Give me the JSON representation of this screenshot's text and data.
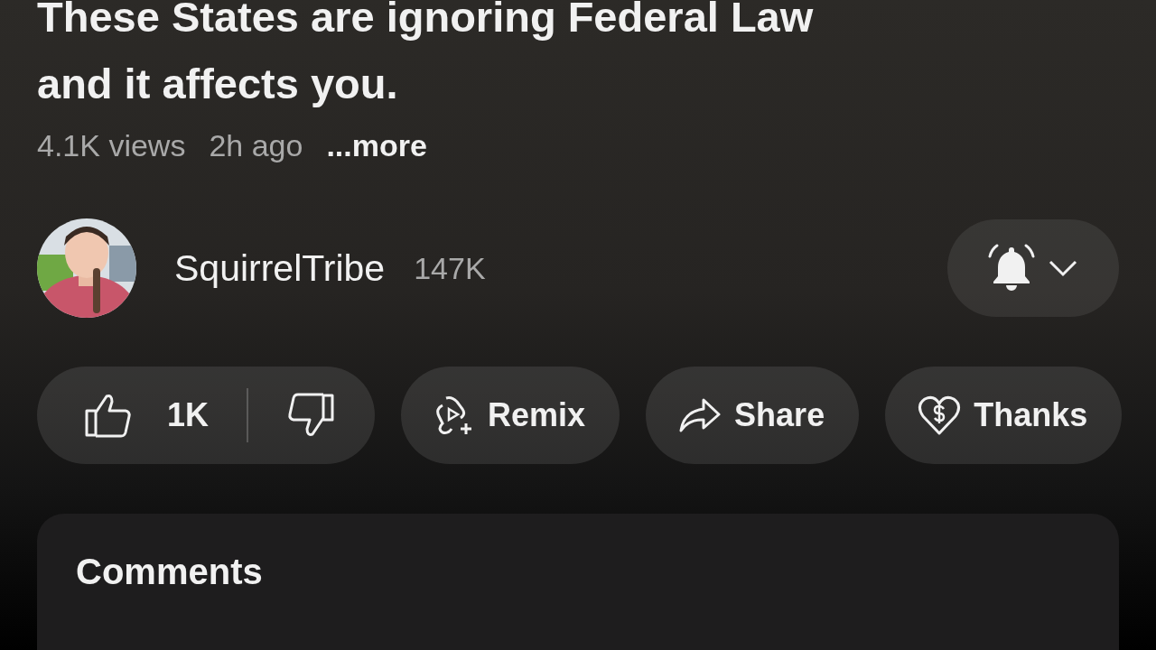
{
  "video": {
    "title_lines": [
      "These States are ignoring Federal Law",
      "and it affects you."
    ],
    "views": "4.1K views",
    "age": "2h ago",
    "more": "...more"
  },
  "channel": {
    "name": "SquirrelTribe",
    "subscribers": "147K"
  },
  "actions": [
    {
      "kind": "like",
      "label": "1K"
    },
    {
      "kind": "remix",
      "label": "Remix"
    },
    {
      "kind": "share",
      "label": "Share"
    },
    {
      "kind": "thanks",
      "label": "Thanks"
    }
  ],
  "comments": {
    "title": "Comments"
  }
}
